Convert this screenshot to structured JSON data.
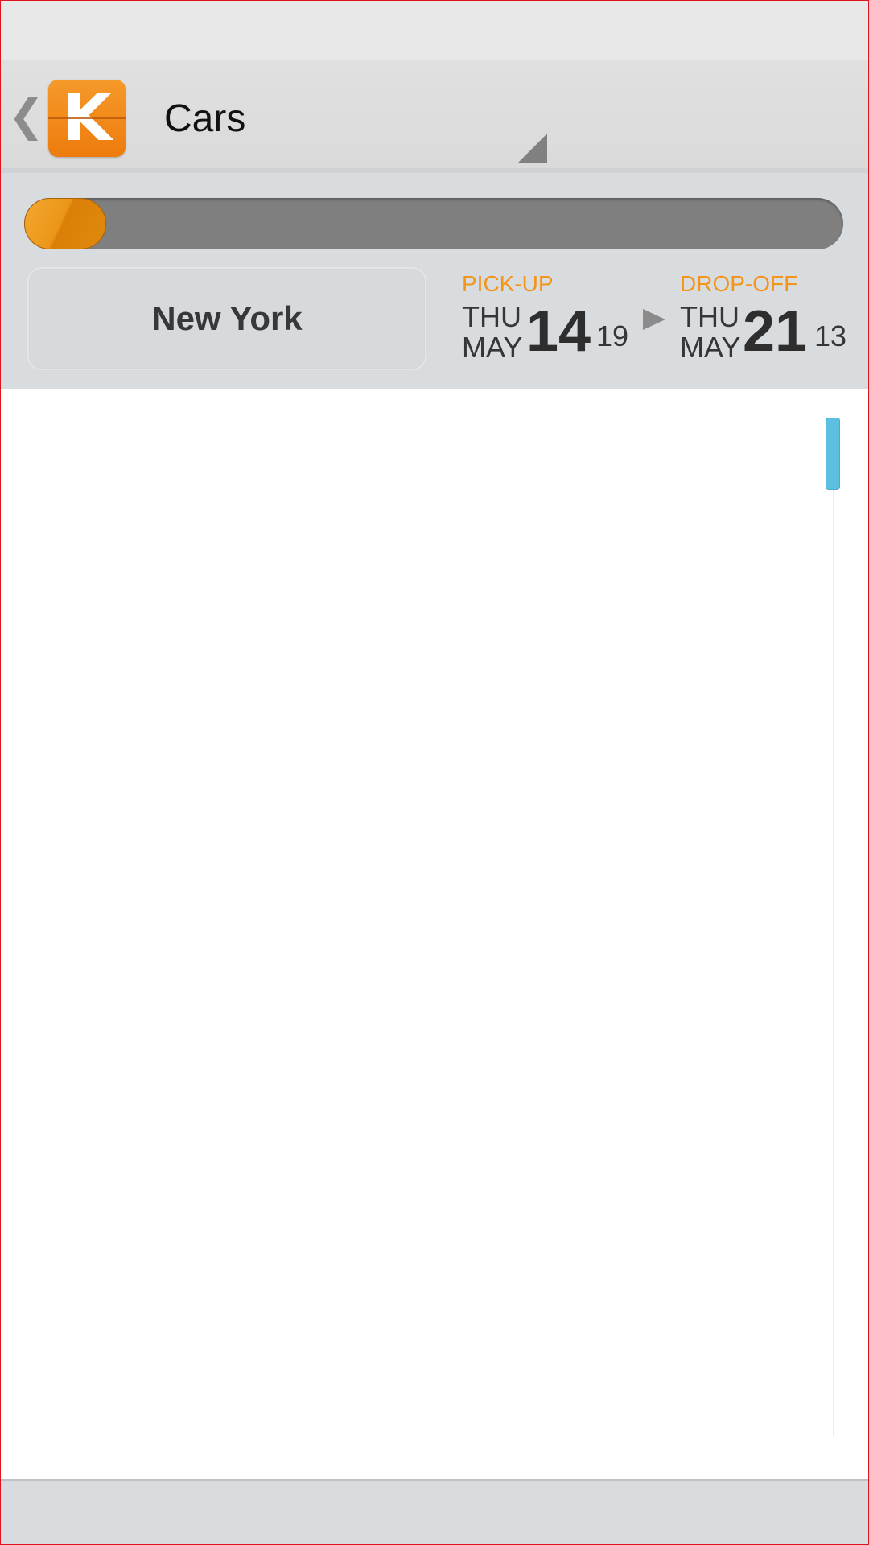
{
  "header": {
    "back_icon": "chevron-left-icon",
    "logo_letter": "K",
    "title": "Cars",
    "dropdown_icon": "corner-triangle-icon"
  },
  "search": {
    "progress_fraction": 0.1,
    "location": "New York",
    "pickup": {
      "caption": "PICK-UP",
      "day_of_week": "THU",
      "month": "MAY",
      "day": "14",
      "time": "19"
    },
    "dropoff": {
      "caption": "DROP-OFF",
      "day_of_week": "THU",
      "month": "MAY",
      "day": "21",
      "time": "13"
    },
    "arrow_icon": "play-arrow-icon"
  },
  "colors": {
    "accent_orange": "#f3941b",
    "logo_orange": "#ee7b0d",
    "scroll_thumb": "#5bbfe0"
  }
}
